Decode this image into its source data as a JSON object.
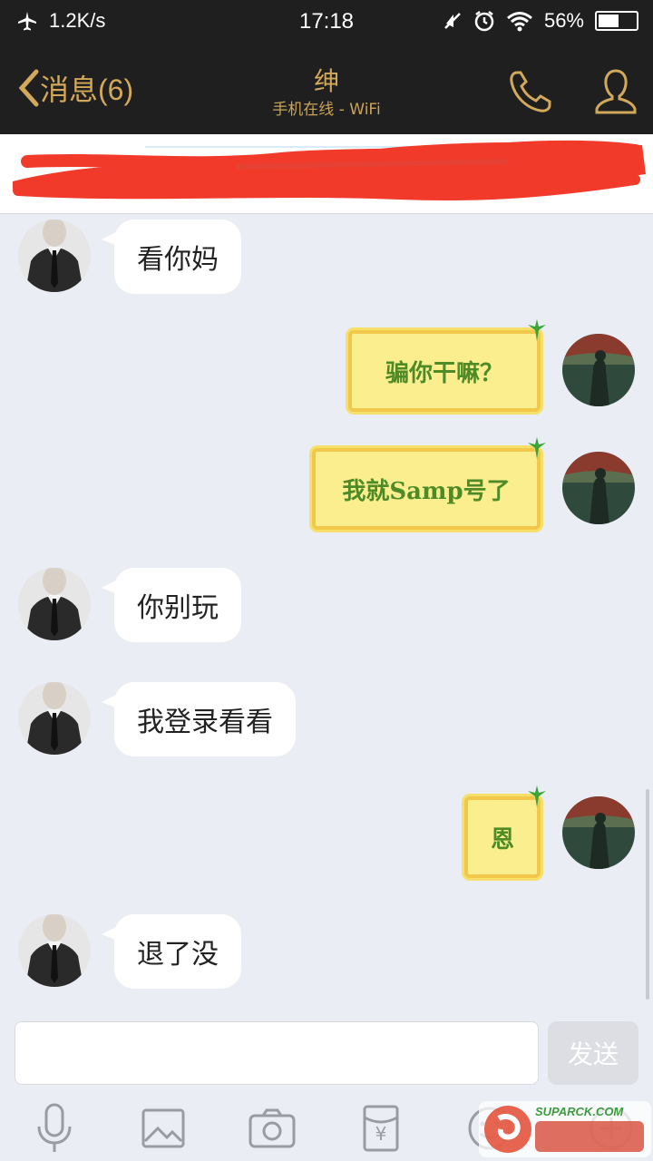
{
  "status_bar": {
    "net_speed": "1.2K/s",
    "time": "17:18",
    "battery_text": "56%",
    "battery_level": 0.56
  },
  "nav": {
    "back_label": "消息(6)",
    "contact_name": "绅",
    "online_status": "手机在线 - WiFi",
    "accent_color": "#d2a85a"
  },
  "messages": [
    {
      "side": "left",
      "type": "text",
      "text": "看你妈"
    },
    {
      "side": "right",
      "type": "sticker",
      "text": "骗你干嘛？"
    },
    {
      "side": "right",
      "type": "sticker",
      "text": "我就Samp号了"
    },
    {
      "side": "left",
      "type": "text",
      "text": "你别玩"
    },
    {
      "side": "left",
      "type": "text",
      "text": "我登录看看"
    },
    {
      "side": "right",
      "type": "sticker",
      "text": "恩"
    },
    {
      "side": "left",
      "type": "text",
      "text": "退了没"
    }
  ],
  "composer": {
    "input_value": "",
    "send_label": "发送"
  },
  "toolbar": {
    "icons": [
      "microphone-icon",
      "image-icon",
      "camera-icon",
      "red-packet-icon",
      "emoji-icon",
      "plus-icon"
    ],
    "red_packet_symbol": "¥"
  },
  "watermark": {
    "text": "SUPARCK.COM"
  }
}
